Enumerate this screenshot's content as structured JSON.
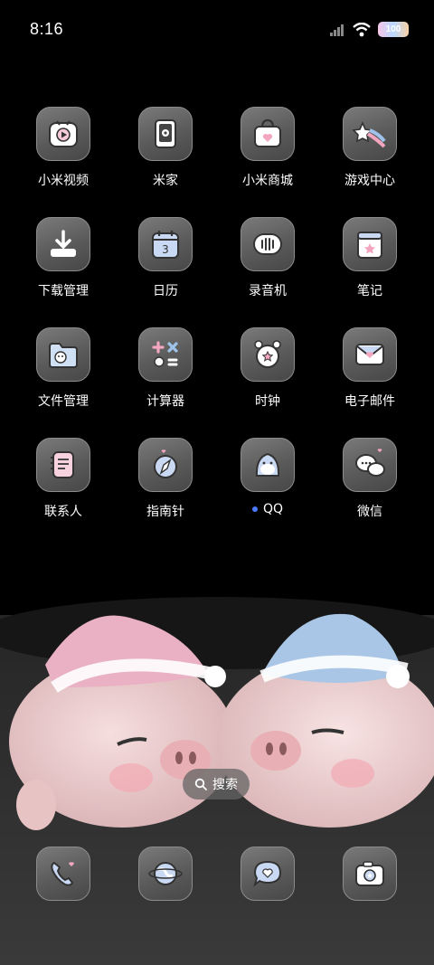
{
  "status_bar": {
    "time": "8:16",
    "battery": "100"
  },
  "apps": [
    {
      "label": "小米视频",
      "icon": "video-icon"
    },
    {
      "label": "米家",
      "icon": "home-device-icon"
    },
    {
      "label": "小米商城",
      "icon": "shopping-bag-icon"
    },
    {
      "label": "游戏中心",
      "icon": "game-star-icon"
    },
    {
      "label": "下载管理",
      "icon": "download-icon"
    },
    {
      "label": "日历",
      "icon": "calendar-icon",
      "badge_text": "3"
    },
    {
      "label": "录音机",
      "icon": "recorder-icon"
    },
    {
      "label": "笔记",
      "icon": "notes-icon"
    },
    {
      "label": "文件管理",
      "icon": "folder-icon"
    },
    {
      "label": "计算器",
      "icon": "calculator-icon"
    },
    {
      "label": "时钟",
      "icon": "clock-icon"
    },
    {
      "label": "电子邮件",
      "icon": "mail-icon"
    },
    {
      "label": "联系人",
      "icon": "contacts-icon"
    },
    {
      "label": "指南针",
      "icon": "compass-icon"
    },
    {
      "label": "QQ",
      "icon": "qq-penguin-icon",
      "new_dot": true
    },
    {
      "label": "微信",
      "icon": "wechat-icon"
    }
  ],
  "search": {
    "label": "搜索"
  },
  "dock": [
    {
      "icon": "phone-icon"
    },
    {
      "icon": "browser-globe-icon"
    },
    {
      "icon": "messages-icon"
    },
    {
      "icon": "camera-icon"
    }
  ],
  "colors": {
    "tile": "#5f5f5f",
    "dot": "#4a7bff"
  }
}
